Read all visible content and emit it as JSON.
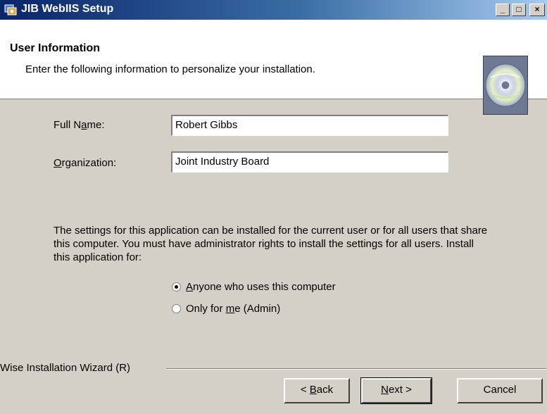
{
  "window": {
    "title": "JIB WebIIS Setup",
    "min_label": "_",
    "max_label": "□",
    "close_label": "×"
  },
  "header": {
    "title": "User Information",
    "subtitle": "Enter the following information to personalize your installation."
  },
  "form": {
    "full_name_label_pre": "Full N",
    "full_name_label_u": "a",
    "full_name_label_post": "me:",
    "full_name_value": "Robert Gibbs",
    "org_label_u": "O",
    "org_label_post": "rganization:",
    "org_value": "Joint Industry Board"
  },
  "install": {
    "description": "The settings for this application can be installed for the current user or for all users that share this computer. You must have administrator rights to install the settings for all users. Install this application for:",
    "options": [
      {
        "pre": "",
        "u": "A",
        "post": "nyone who uses this computer",
        "selected": true
      },
      {
        "pre": "Only for ",
        "u": "m",
        "post": "e (Admin)",
        "selected": false
      }
    ]
  },
  "footer": {
    "brand": "Wise Installation Wizard (R)",
    "back_pre": "< ",
    "back_u": "B",
    "back_post": "ack",
    "next_u": "N",
    "next_post": "ext >",
    "cancel": "Cancel"
  }
}
